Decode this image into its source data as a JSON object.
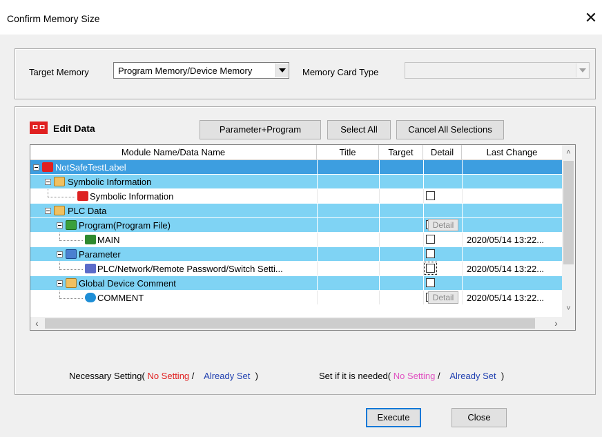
{
  "window": {
    "title": "Confirm Memory Size",
    "close_glyph": "✕"
  },
  "target_memory": {
    "label": "Target Memory",
    "value": "Program Memory/Device Memory"
  },
  "memory_card_type": {
    "label": "Memory Card Type",
    "value": ""
  },
  "edit_data": {
    "icon_text": "ㅁㅁ",
    "label": "Edit Data",
    "buttons": {
      "param_program": "Parameter+Program",
      "select_all": "Select All",
      "cancel_all": "Cancel All Selections"
    }
  },
  "table": {
    "columns": [
      "Module Name/Data Name",
      "Title",
      "Target",
      "Detail",
      "Last Change"
    ],
    "rows": [
      {
        "name": "NotSafeTestLabel",
        "title": "",
        "target": false,
        "detail": "",
        "last_change": ""
      },
      {
        "name": "Symbolic Information",
        "title": "",
        "target": false,
        "detail": "",
        "last_change": ""
      },
      {
        "name": "Symbolic Information",
        "title": "",
        "target": true,
        "detail": "",
        "last_change": ""
      },
      {
        "name": "PLC Data",
        "title": "",
        "target": false,
        "detail": "",
        "last_change": ""
      },
      {
        "name": "Program(Program File)",
        "title": "",
        "target": true,
        "detail": "Detail",
        "last_change": ""
      },
      {
        "name": "MAIN",
        "title": "",
        "target": true,
        "detail": "",
        "last_change": "2020/05/14 13:22..."
      },
      {
        "name": "Parameter",
        "title": "",
        "target": true,
        "detail": "",
        "last_change": ""
      },
      {
        "name": "PLC/Network/Remote Password/Switch Setti...",
        "title": "",
        "target": true,
        "detail": "",
        "last_change": "2020/05/14 13:22..."
      },
      {
        "name": "Global Device Comment",
        "title": "",
        "target": true,
        "detail": "",
        "last_change": ""
      },
      {
        "name": "COMMENT",
        "title": "",
        "target": true,
        "detail": "Detail",
        "last_change": "2020/05/14 13:22..."
      }
    ]
  },
  "legend": {
    "necessary_prefix": "Necessary Setting(",
    "no_setting": "No Setting",
    "slash": "/",
    "already_set": "Already Set",
    "close_paren": ")",
    "if_needed_prefix": "Set if it is needed("
  },
  "footer": {
    "execute": "Execute",
    "close": "Close"
  },
  "colors": {
    "row_blue": "#7fd3f4",
    "row_selected": "#3d9ee0",
    "red": "#e02020",
    "blue": "#2040b0",
    "pink": "#e050c0"
  }
}
